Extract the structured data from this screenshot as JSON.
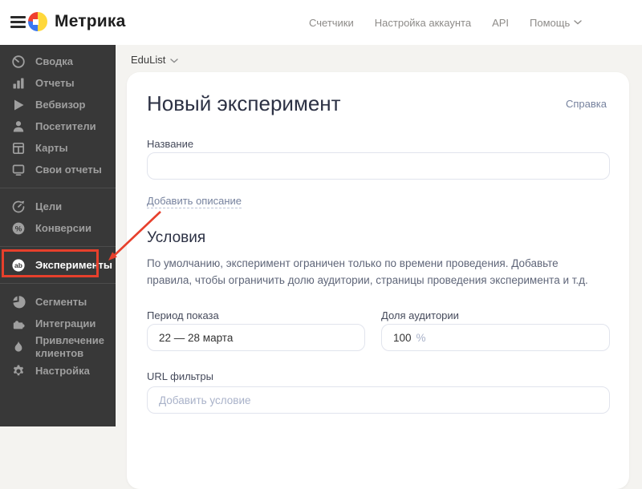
{
  "header": {
    "app_name": "Метрика",
    "menu": [
      {
        "name": "counters",
        "label": "Счетчики",
        "has_chevron": false
      },
      {
        "name": "account-settings",
        "label": "Настройка аккаунта",
        "has_chevron": false
      },
      {
        "name": "api",
        "label": "API",
        "has_chevron": false
      },
      {
        "name": "help",
        "label": "Помощь",
        "has_chevron": true
      }
    ]
  },
  "sidebar": {
    "groups": [
      {
        "items": [
          {
            "name": "summary",
            "icon": "gauge-icon",
            "label": "Сводка",
            "active": false
          },
          {
            "name": "reports",
            "icon": "bar-chart-icon",
            "label": "Отчеты",
            "active": false
          },
          {
            "name": "webvisor",
            "icon": "play-icon",
            "label": "Вебвизор",
            "active": false
          },
          {
            "name": "visitors",
            "icon": "person-icon",
            "label": "Посетители",
            "active": false
          },
          {
            "name": "maps",
            "icon": "layout-icon",
            "label": "Карты",
            "active": false
          },
          {
            "name": "custom-reports",
            "icon": "monitor-icon",
            "label": "Свои отчеты",
            "active": false
          }
        ]
      },
      {
        "items": [
          {
            "name": "goals",
            "icon": "goal-icon",
            "label": "Цели",
            "active": false
          },
          {
            "name": "conversions",
            "icon": "percent-icon",
            "label": "Конверсии",
            "active": false
          }
        ]
      },
      {
        "items": [
          {
            "name": "experiments",
            "icon": "ab-icon",
            "label": "Эксперименты",
            "active": true
          }
        ]
      },
      {
        "items": [
          {
            "name": "segments",
            "icon": "pie-icon",
            "label": "Сегменты",
            "active": false
          },
          {
            "name": "integrations",
            "icon": "puzzle-icon",
            "label": "Интеграции",
            "active": false
          },
          {
            "name": "client-acquisition",
            "icon": "flame-icon",
            "label": "Привлечение клиентов",
            "active": false
          },
          {
            "name": "settings",
            "icon": "gear-icon",
            "label": "Настройка",
            "active": false
          }
        ]
      }
    ]
  },
  "breadcrumb": {
    "label": "EduList"
  },
  "card": {
    "title": "Новый эксперимент",
    "help_link": "Справка",
    "name_label": "Название",
    "name_value": "",
    "add_description_link": "Добавить описание",
    "conditions": {
      "heading": "Условия",
      "description": "По умолчанию, эксперимент ограничен только по времени проведения. Добавьте правила, чтобы ограничить долю аудитории, страницы проведения эксперимента и т.д.",
      "period_label": "Период показа",
      "period_value": "22 — 28 марта",
      "audience_label": "Доля аудитории",
      "audience_value": "100",
      "audience_unit": "%",
      "url_filters_label": "URL фильтры",
      "url_filters_placeholder": "Добавить условие"
    }
  },
  "annotation": {
    "highlighted_item": "Эксперименты",
    "color": "#e7402c"
  },
  "colors": {
    "sidebar_bg": "#383838",
    "content_bg": "#f4f3f0",
    "link_muted": "#76829e",
    "annotation_red": "#e7402c",
    "logo_red": "#f0402f",
    "logo_yellow": "#ffd83b",
    "logo_blue": "#3a77f0"
  }
}
